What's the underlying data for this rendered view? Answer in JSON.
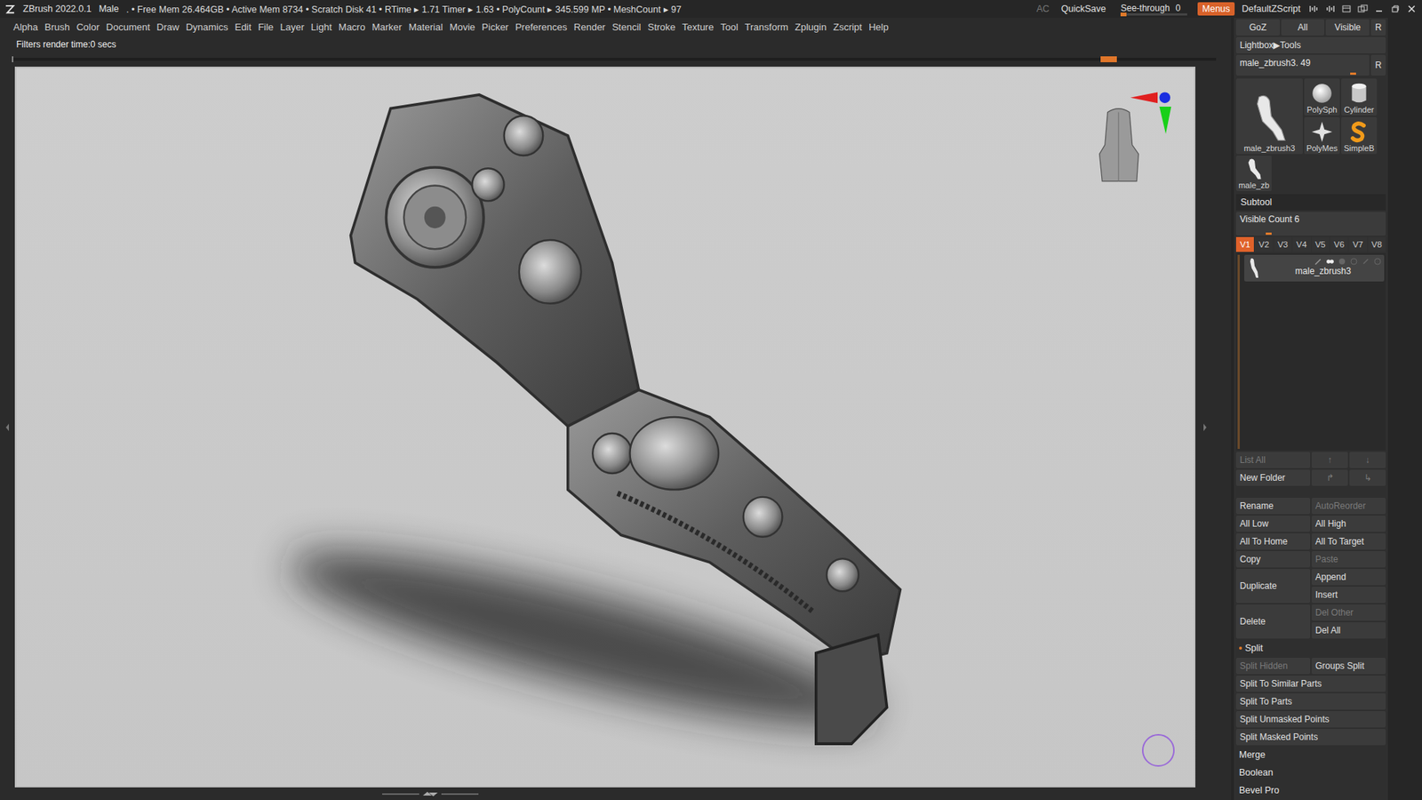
{
  "window": {
    "title": "ZBrush 2022.0.1",
    "document": "Male",
    "stats": ". • Free Mem 26.464GB • Active Mem 8734 • Scratch Disk 41 • RTime ▸ 1.71 Timer ▸ 1.63 • PolyCount ▸ 345.599 MP • MeshCount ▸ 97"
  },
  "title_bar": {
    "ac": "AC",
    "quicksave": "QuickSave",
    "see_through": {
      "label": "See-through",
      "value": "0",
      "level": 0.0
    },
    "menus": {
      "label": "Menus",
      "on": true
    },
    "script": "DefaultZScript"
  },
  "menu_bar": [
    "Alpha",
    "Brush",
    "Color",
    "Document",
    "Draw",
    "Dynamics",
    "Edit",
    "File",
    "Layer",
    "Light",
    "Macro",
    "Marker",
    "Material",
    "Movie",
    "Picker",
    "Preferences",
    "Render",
    "Stencil",
    "Stroke",
    "Texture",
    "Tool",
    "Transform",
    "Zplugin",
    "Zscript",
    "Help"
  ],
  "message": "Filters render time:0 secs",
  "timeline": {
    "level": 0.904
  },
  "tool_panel": {
    "top_buttons": [
      "GoZ",
      "All",
      "Visible",
      "R"
    ],
    "lightbox": "Lightbox▶Tools",
    "tool_slider": {
      "label": "male_zbrush3. 49",
      "level": 0.9,
      "reset": "R"
    },
    "tools": [
      {
        "label": "male_zbrush3",
        "kind": "figure"
      },
      {
        "label": "PolySph",
        "kind": "sphere"
      },
      {
        "label": "Cylinder",
        "kind": "cylinder"
      },
      {
        "label": "PolyMes",
        "kind": "star"
      },
      {
        "label": "SimpleB",
        "kind": "simpleb"
      },
      {
        "label": "male_zb",
        "kind": "figure-small"
      }
    ]
  },
  "subtool": {
    "header": "Subtool",
    "visible_count": {
      "label": "Visible Count 6",
      "level": 0.24
    },
    "versions": [
      {
        "label": "V1",
        "selected": true
      },
      {
        "label": "V2",
        "selected": false
      },
      {
        "label": "V3",
        "selected": false
      },
      {
        "label": "V4",
        "selected": false
      },
      {
        "label": "V5",
        "selected": false
      },
      {
        "label": "V6",
        "selected": false
      },
      {
        "label": "V7",
        "selected": false
      },
      {
        "label": "V8",
        "selected": false
      }
    ],
    "items": [
      {
        "name": "male_zbrush3",
        "selected": true
      }
    ],
    "folder_actions": [
      {
        "label": "List All",
        "disabled": true,
        "arrows": [
          {
            "label": "↑",
            "disabled": true
          },
          {
            "label": "↓",
            "disabled": true
          }
        ]
      },
      {
        "label": "New Folder",
        "disabled": false,
        "arrows": [
          {
            "label": "↱",
            "disabled": true
          },
          {
            "label": "↳",
            "disabled": true
          }
        ]
      }
    ],
    "actions": [
      {
        "left": {
          "label": "Rename",
          "disabled": false
        },
        "right": [
          {
            "label": "AutoReorder",
            "disabled": true
          }
        ]
      },
      {
        "left": {
          "label": "All Low",
          "disabled": false
        },
        "right": [
          {
            "label": "All High",
            "disabled": false
          }
        ]
      },
      {
        "left": {
          "label": "All To Home",
          "disabled": false
        },
        "right": [
          {
            "label": "All To Target",
            "disabled": false
          }
        ]
      },
      {
        "left": {
          "label": "Copy",
          "disabled": false
        },
        "right": [
          {
            "label": "Paste",
            "disabled": true
          }
        ]
      },
      {
        "left": {
          "label": "Duplicate",
          "disabled": false
        },
        "right": [
          {
            "label": "Append",
            "disabled": false
          },
          {
            "label": "Insert",
            "disabled": false
          }
        ]
      },
      {
        "left": {
          "label": "Delete",
          "disabled": false
        },
        "right": [
          {
            "label": "Del Other",
            "disabled": true
          },
          {
            "label": "Del All",
            "disabled": false
          }
        ]
      }
    ],
    "split": {
      "header": "Split",
      "expanded": true,
      "pair": [
        {
          "label": "Split Hidden",
          "disabled": true
        },
        {
          "label": "Groups Split",
          "disabled": false
        }
      ],
      "items": [
        {
          "label": "Split To Similar Parts",
          "disabled": false
        },
        {
          "label": "Split To Parts",
          "disabled": false
        },
        {
          "label": "Split Unmasked Points",
          "disabled": false
        },
        {
          "label": "Split Masked Points",
          "disabled": false
        }
      ]
    },
    "sections": [
      "Merge",
      "Boolean",
      "Bevel Pro"
    ]
  }
}
